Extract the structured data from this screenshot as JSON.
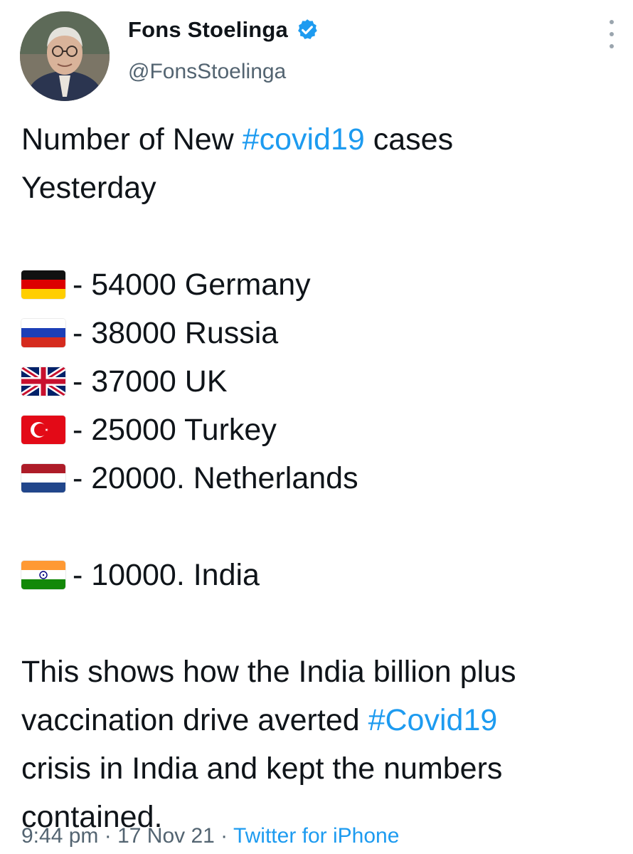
{
  "author": {
    "display_name": "Fons Stoelinga",
    "handle": "@FonsStoelinga",
    "verified": true
  },
  "tweet": {
    "intro": {
      "part1": "Number of New ",
      "hashtag": "#covid19",
      "part2": " cases",
      "line2": "Yesterday"
    },
    "rows": [
      {
        "flag": "germany-flag",
        "text": "- 54000 Germany"
      },
      {
        "flag": "russia-flag",
        "text": "- 38000 Russia"
      },
      {
        "flag": "uk-flag",
        "text": "- 37000  UK"
      },
      {
        "flag": "turkey-flag",
        "text": "- 25000  Turkey"
      },
      {
        "flag": "netherlands-flag",
        "text": "- 20000. Netherlands"
      },
      {
        "flag": "india-flag",
        "text": "- 10000. India"
      }
    ],
    "closing": {
      "line1": "This shows how the India billion plus",
      "line2_part1": "vaccination drive averted ",
      "line2_hashtag": "#Covid19",
      "line3": "crisis in India and kept the numbers",
      "line4": "contained."
    }
  },
  "meta": {
    "time": "9:44 pm",
    "sep1": " · ",
    "date": "17 Nov 21",
    "sep2": " · ",
    "source": "Twitter for iPhone"
  },
  "colors": {
    "link": "#1d9bf0",
    "secondary_text": "#536471",
    "text": "#0f1419"
  }
}
